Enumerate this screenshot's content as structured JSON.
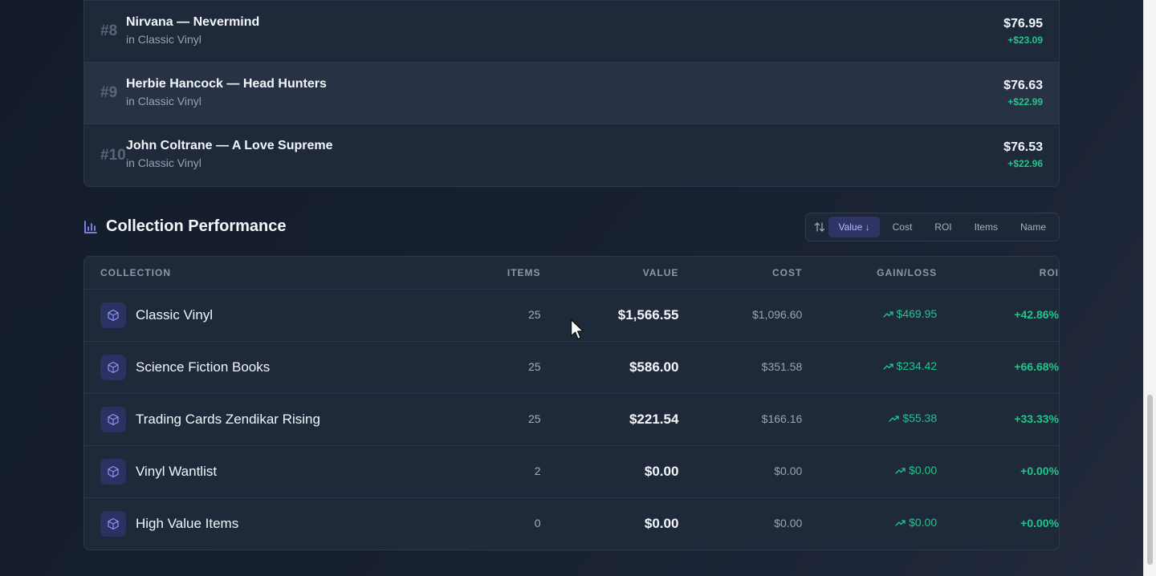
{
  "top_items": [
    {
      "rank": "#8",
      "title": "Nirvana — Nevermind",
      "collection": "in Classic Vinyl",
      "value": "$76.95",
      "gain": "+$23.09"
    },
    {
      "rank": "#9",
      "title": "Herbie Hancock — Head Hunters",
      "collection": "in Classic Vinyl",
      "value": "$76.63",
      "gain": "+$22.99"
    },
    {
      "rank": "#10",
      "title": "John Coltrane — A Love Supreme",
      "collection": "in Classic Vinyl",
      "value": "$76.53",
      "gain": "+$22.96"
    }
  ],
  "section": {
    "title": "Collection Performance",
    "icon": "bar-chart-icon"
  },
  "sort": {
    "icon": "sort-arrows-icon",
    "options": [
      "Value ↓",
      "Cost",
      "ROI",
      "Items",
      "Name"
    ],
    "active": "Value ↓"
  },
  "table": {
    "headers": {
      "collection": "COLLECTION",
      "items": "ITEMS",
      "value": "VALUE",
      "cost": "COST",
      "gain": "GAIN/LOSS",
      "roi": "ROI"
    },
    "rows": [
      {
        "name": "Classic Vinyl",
        "items": "25",
        "value": "$1,566.55",
        "cost": "$1,096.60",
        "gain": "$469.95",
        "roi": "+42.86%"
      },
      {
        "name": "Science Fiction Books",
        "items": "25",
        "value": "$586.00",
        "cost": "$351.58",
        "gain": "$234.42",
        "roi": "+66.68%"
      },
      {
        "name": "Trading Cards Zendikar Rising",
        "items": "25",
        "value": "$221.54",
        "cost": "$166.16",
        "gain": "$55.38",
        "roi": "+33.33%"
      },
      {
        "name": "Vinyl Wantlist",
        "items": "2",
        "value": "$0.00",
        "cost": "$0.00",
        "gain": "$0.00",
        "roi": "+0.00%"
      },
      {
        "name": "High Value Items",
        "items": "0",
        "value": "$0.00",
        "cost": "$0.00",
        "gain": "$0.00",
        "roi": "+0.00%"
      }
    ]
  },
  "colors": {
    "accent": "#818cf8",
    "positive": "#22c58b"
  }
}
